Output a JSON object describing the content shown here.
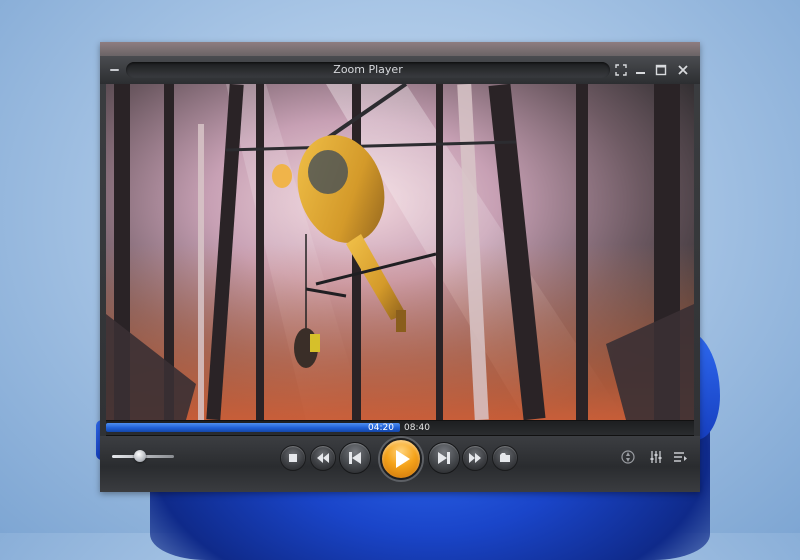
{
  "window": {
    "title": "Zoom Player"
  },
  "playback": {
    "current_time": "04:20",
    "total_time": "08:40",
    "progress": 0.5,
    "volume": 0.45
  },
  "controls": {
    "icons": [
      "stop-icon",
      "rewind-icon",
      "previous-icon",
      "play-icon",
      "next-icon",
      "fast-forward-icon",
      "open-file-icon"
    ]
  },
  "colors": {
    "accent_play": "#f5a31a",
    "seek_fill": "#1f5fd6",
    "frame": "#2e3033"
  }
}
